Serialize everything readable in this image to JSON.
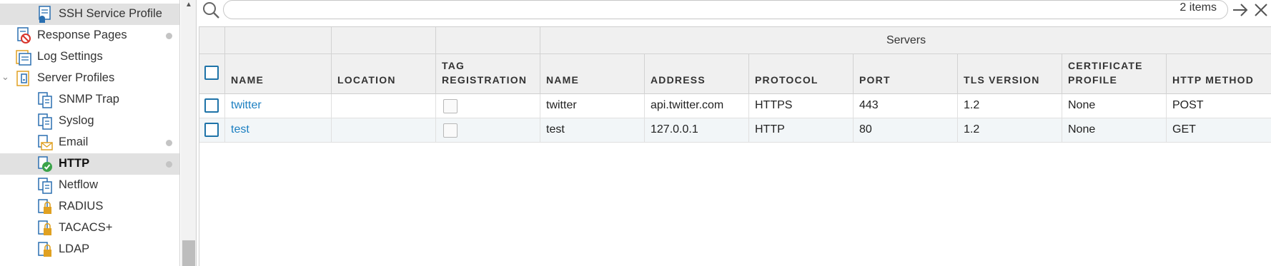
{
  "sidebar": {
    "items": [
      {
        "label": "SSH Service Profile",
        "icon": "ssh-profile-icon"
      },
      {
        "label": "Response Pages",
        "icon": "response-pages-icon"
      },
      {
        "label": "Log Settings",
        "icon": "log-settings-icon"
      },
      {
        "label": "Server Profiles",
        "icon": "server-profiles-icon"
      },
      {
        "label": "SNMP Trap",
        "icon": "server-doc-icon"
      },
      {
        "label": "Syslog",
        "icon": "server-doc-icon"
      },
      {
        "label": "Email",
        "icon": "email-icon"
      },
      {
        "label": "HTTP",
        "icon": "http-icon"
      },
      {
        "label": "Netflow",
        "icon": "server-doc-icon"
      },
      {
        "label": "RADIUS",
        "icon": "lock-server-icon"
      },
      {
        "label": "TACACS+",
        "icon": "lock-server-icon"
      },
      {
        "label": "LDAP",
        "icon": "lock-server-icon"
      }
    ],
    "selected": "HTTP"
  },
  "search": {
    "placeholder": "",
    "value": "",
    "item_count": "2 items"
  },
  "table": {
    "group_header": "Servers",
    "columns": {
      "name": "NAME",
      "location": "LOCATION",
      "tag_registration": [
        "TAG",
        "REGISTRATION"
      ],
      "server_name": "NAME",
      "address": "ADDRESS",
      "protocol": "PROTOCOL",
      "port": "PORT",
      "tls_version": "TLS VERSION",
      "certificate_profile": [
        "CERTIFICATE",
        "PROFILE"
      ],
      "http_method": "HTTP METHOD"
    },
    "rows": [
      {
        "name": "twitter",
        "location": "",
        "server_name": "twitter",
        "address": "api.twitter.com",
        "protocol": "HTTPS",
        "port": "443",
        "tls_version": "1.2",
        "certificate_profile": "None",
        "http_method": "POST"
      },
      {
        "name": "test",
        "location": "",
        "server_name": "test",
        "address": "127.0.0.1",
        "protocol": "HTTP",
        "port": "80",
        "tls_version": "1.2",
        "certificate_profile": "None",
        "http_method": "GET"
      }
    ]
  },
  "colors": {
    "link": "#1b7fc1",
    "checkbox": "#1e73a8",
    "selected_row": "#e1e1e1",
    "header_bg": "#f0f0f0",
    "alt_row": "#f2f6f8"
  }
}
